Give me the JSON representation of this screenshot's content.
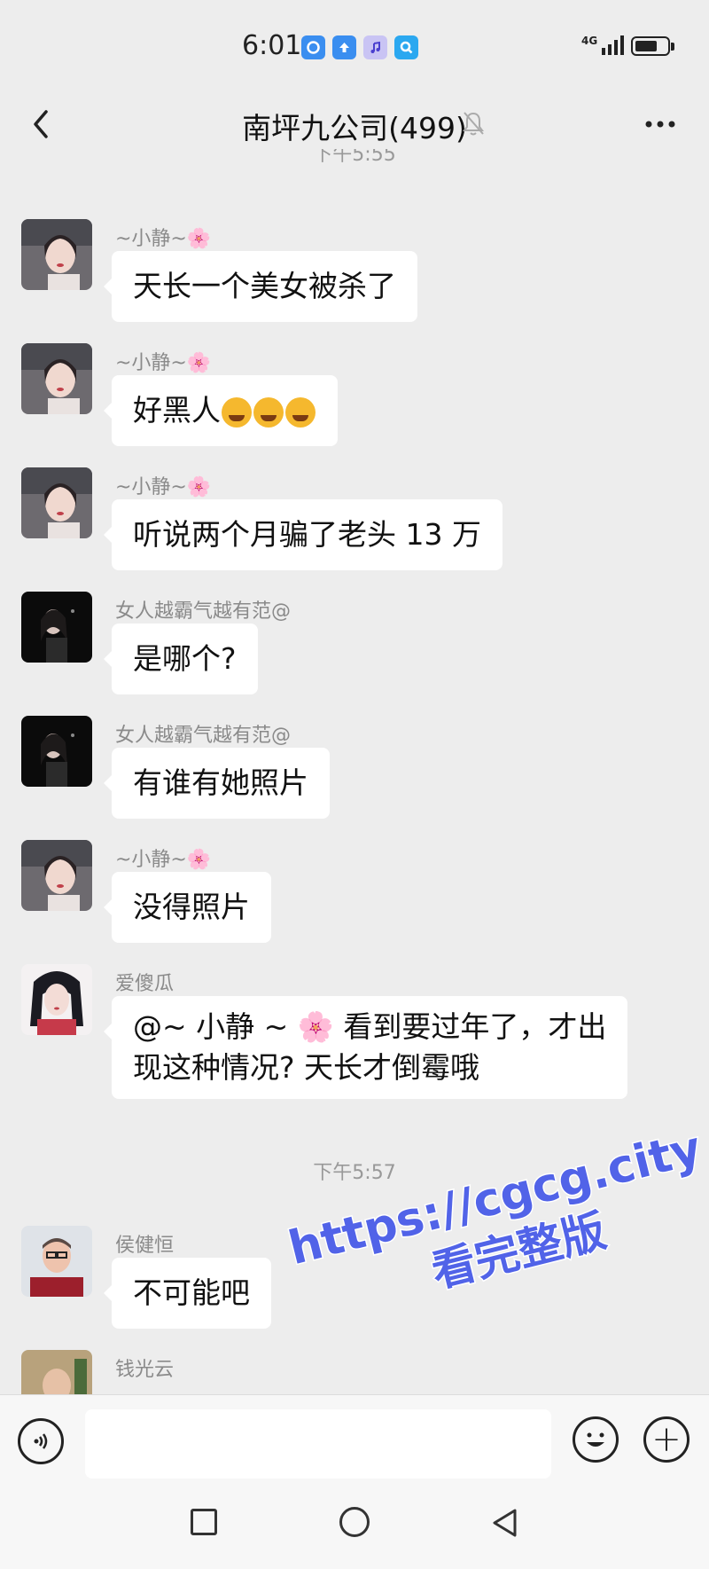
{
  "status_bar": {
    "time": "6:01",
    "network": "4G",
    "app_icons": [
      "circle-app-icon",
      "upload-app-icon",
      "music-app-icon",
      "search-app-icon"
    ],
    "battery_level": 0.7
  },
  "header": {
    "title": "南坪九公司(499)",
    "back_icon": "chevron-left-icon",
    "mute_icon": "bell-off-icon",
    "more_icon": "more-icon"
  },
  "clipped_timestamp": "下午5:55",
  "messages": [
    {
      "sender": "~小静~",
      "sender_emoji": "🌸",
      "text": "天长一个美女被杀了"
    },
    {
      "sender": "~小静~",
      "sender_emoji": "🌸",
      "text": "好黑人",
      "emoji_count": 3,
      "emoji_name": "laugh-cry-emoji"
    },
    {
      "sender": "~小静~",
      "sender_emoji": "🌸",
      "text": "听说两个月骗了老头 13 万"
    },
    {
      "sender": "女人越霸气越有范@",
      "text": "是哪个?"
    },
    {
      "sender": "女人越霸气越有范@",
      "text": "有谁有她照片"
    },
    {
      "sender": "~小静~",
      "sender_emoji": "🌸",
      "text": "没得照片"
    },
    {
      "sender": "爱傻瓜",
      "mention": "@~ 小静 ~",
      "mention_emoji": "🌸",
      "line1": "看到要过年了，才出",
      "line2": "现这种情况? 天长才倒霉哦"
    },
    {
      "sender": "侯健恒",
      "text": "不可能吧"
    },
    {
      "sender": "钱光云",
      "text": ""
    }
  ],
  "time_divider": "下午5:57",
  "input_bar": {
    "voice_icon": "voice-icon",
    "emoji_icon": "smile-icon",
    "add_icon": "plus-icon",
    "add_glyph": "+"
  },
  "watermark": {
    "url": "https://cgcg.city",
    "cta": "看完整版"
  },
  "colors": {
    "background": "#ededed",
    "bubble": "#ffffff",
    "watermark": "#5163e8",
    "sender_name": "#8a8a8a"
  }
}
